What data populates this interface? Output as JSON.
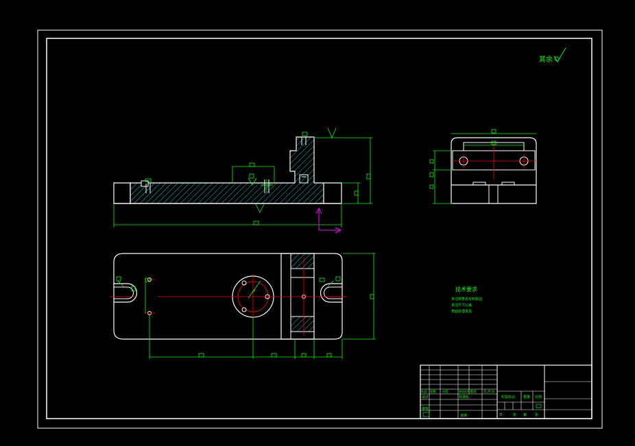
{
  "drawing": {
    "roughness_note": "其余",
    "roughness_symbol": "√",
    "tech_requirements": {
      "title": "技术要求",
      "lines": [
        "未注倒角去毛刺锐边.",
        "未注尺寸公差.",
        "表面处理发黑."
      ]
    },
    "dimension_label": "□"
  },
  "title_block": {
    "revision_headers": [
      "标记",
      "处数",
      "分区",
      "更改文件号",
      "签名",
      "年.月.日"
    ],
    "design_label": "设计",
    "standardization_label": "标准化",
    "stage_label": "阶段标记",
    "weight_label": "重量",
    "scale_label": "比例",
    "approve_label": "批准",
    "sheet_total_label": "共",
    "sheet_label": "张",
    "sheet_no_label": "第",
    "sheet_no_suffix": "张",
    "review_label": "审核"
  },
  "colors": {
    "outline": "#ffffff",
    "dimension": "#00ff00",
    "center_line": "#ff0000",
    "hatch": "#00ffff",
    "ucs": "#ff00ff",
    "background": "#000000"
  }
}
